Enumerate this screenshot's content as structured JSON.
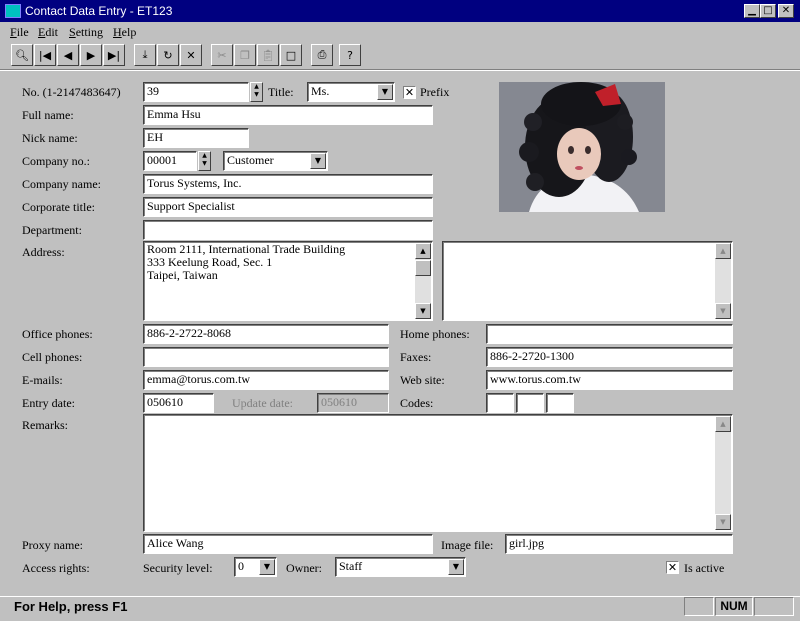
{
  "window": {
    "title": "Contact Data Entry - ET123"
  },
  "menu": [
    {
      "pre": "",
      "acc": "F",
      "post": "ile"
    },
    {
      "pre": "",
      "acc": "E",
      "post": "dit"
    },
    {
      "pre": "",
      "acc": "S",
      "post": "etting"
    },
    {
      "pre": "",
      "acc": "H",
      "post": "elp"
    }
  ],
  "labels": {
    "no": "No. (1-2147483647)",
    "title": "Title:",
    "prefix": "Prefix",
    "full_name": "Full name:",
    "nick_name": "Nick name:",
    "company_no": "Company no.:",
    "company_name": "Company name:",
    "corporate_title": "Corporate title:",
    "department": "Department:",
    "address": "Address:",
    "office_phones": "Office phones:",
    "home_phones": "Home phones:",
    "cell_phones": "Cell phones:",
    "faxes": "Faxes:",
    "emails": "E-mails:",
    "web_site": "Web site:",
    "entry_date": "Entry date:",
    "update_date": "Update date:",
    "codes": "Codes:",
    "remarks": "Remarks:",
    "proxy_name": "Proxy name:",
    "image_file": "Image file:",
    "access_rights": "Access rights:",
    "security_level": "Security level:",
    "owner": "Owner:",
    "is_active": "Is active"
  },
  "values": {
    "no": "39",
    "title": "Ms.",
    "prefix_checked": "✕",
    "full_name": "Emma Hsu",
    "nick_name": "EH",
    "company_no": "00001",
    "company_type": "Customer",
    "company_name": "Torus Systems, Inc.",
    "corporate_title": "Support Specialist",
    "department": "",
    "address_lines": [
      "Room 2111, International Trade Building",
      "333 Keelung Road, Sec. 1",
      "Taipei, Taiwan"
    ],
    "address2": "",
    "office_phones": "886-2-2722-8068",
    "home_phones": "",
    "cell_phones": "",
    "faxes": "886-2-2720-1300",
    "emails": "emma@torus.com.tw",
    "web_site": "www.torus.com.tw",
    "entry_date": "050610",
    "update_date": "050610",
    "codes": [
      "",
      "",
      ""
    ],
    "remarks": "",
    "proxy_name": "Alice Wang",
    "image_file": "girl.jpg",
    "security_level": "0",
    "owner": "Staff",
    "is_active_checked": "✕"
  },
  "status": {
    "help": "For Help, press F1",
    "num": "NUM"
  },
  "colors": {
    "titlebar": "#000080",
    "face": "#c0c0c0"
  }
}
